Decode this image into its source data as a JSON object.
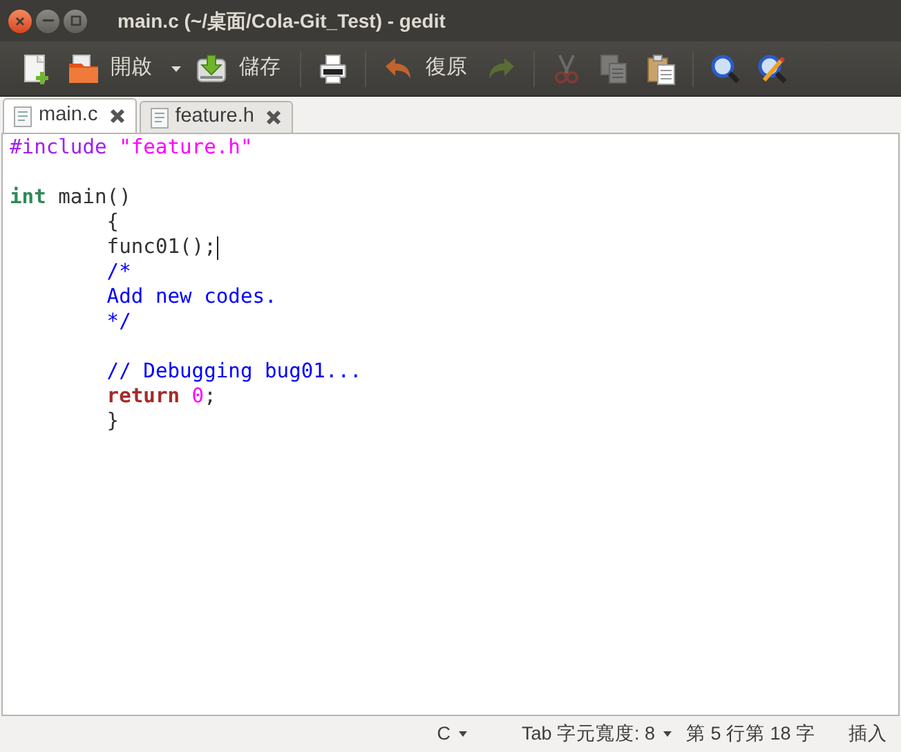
{
  "window": {
    "title": "main.c (~/桌面/Cola-Git_Test) - gedit"
  },
  "toolbar": [
    {
      "kind": "new",
      "disabled": false
    },
    {
      "kind": "open",
      "label": "開啟",
      "disabled": false
    },
    {
      "kind": "dropdown",
      "disabled": false
    },
    {
      "kind": "save",
      "label": "儲存",
      "disabled": false
    },
    {
      "kind": "separator"
    },
    {
      "kind": "print",
      "disabled": false
    },
    {
      "kind": "separator"
    },
    {
      "kind": "undo",
      "label": "復原",
      "disabled": false
    },
    {
      "kind": "redo",
      "disabled": true
    },
    {
      "kind": "separator"
    },
    {
      "kind": "cut",
      "disabled": true
    },
    {
      "kind": "copy",
      "disabled": true
    },
    {
      "kind": "paste",
      "disabled": false
    },
    {
      "kind": "separator"
    },
    {
      "kind": "find",
      "disabled": false
    },
    {
      "kind": "replace",
      "disabled": false
    }
  ],
  "tabs": [
    {
      "label": "main.c",
      "selected": true
    },
    {
      "label": "feature.h",
      "selected": false
    }
  ],
  "editor": {
    "lines": [
      {
        "cursor": false,
        "tokens": [
          {
            "kind": "preprocessor",
            "text": "#include "
          },
          {
            "kind": "string",
            "text": "\"feature.h\""
          }
        ]
      },
      {
        "cursor": false
      },
      {
        "cursor": false,
        "tokens": [
          {
            "kind": "type",
            "text": "int"
          },
          {
            "kind": "plain",
            "text": " main()"
          }
        ]
      },
      {
        "cursor": false,
        "tokens": [
          {
            "kind": "plain",
            "text": "\t{"
          }
        ]
      },
      {
        "cursor": true,
        "tokens": [
          {
            "kind": "plain",
            "text": "\tfunc01();"
          }
        ]
      },
      {
        "cursor": false,
        "tokens": [
          {
            "kind": "comment",
            "text": "\t/*"
          }
        ]
      },
      {
        "cursor": false,
        "tokens": [
          {
            "kind": "comment",
            "text": "\tAdd new codes."
          }
        ]
      },
      {
        "cursor": false,
        "tokens": [
          {
            "kind": "comment",
            "text": "\t*/"
          }
        ]
      },
      {
        "cursor": false
      },
      {
        "cursor": false,
        "tokens": [
          {
            "kind": "comment",
            "text": "\t// Debugging bug01..."
          }
        ]
      },
      {
        "cursor": false,
        "tokens": [
          {
            "kind": "keyword",
            "text": "\treturn"
          },
          {
            "kind": "number",
            "text": " 0"
          },
          {
            "kind": "plain",
            "text": ";"
          }
        ]
      },
      {
        "cursor": false,
        "tokens": [
          {
            "kind": "plain",
            "text": "\t}"
          }
        ]
      }
    ]
  },
  "status_bar": [
    {
      "text": "C",
      "dropdown": true
    },
    {
      "text": "Tab 字元寬度: 8",
      "dropdown": true
    },
    {
      "text": "第 5 行第 18 字",
      "dropdown": false
    },
    {
      "text": "插入",
      "dropdown": false
    }
  ]
}
